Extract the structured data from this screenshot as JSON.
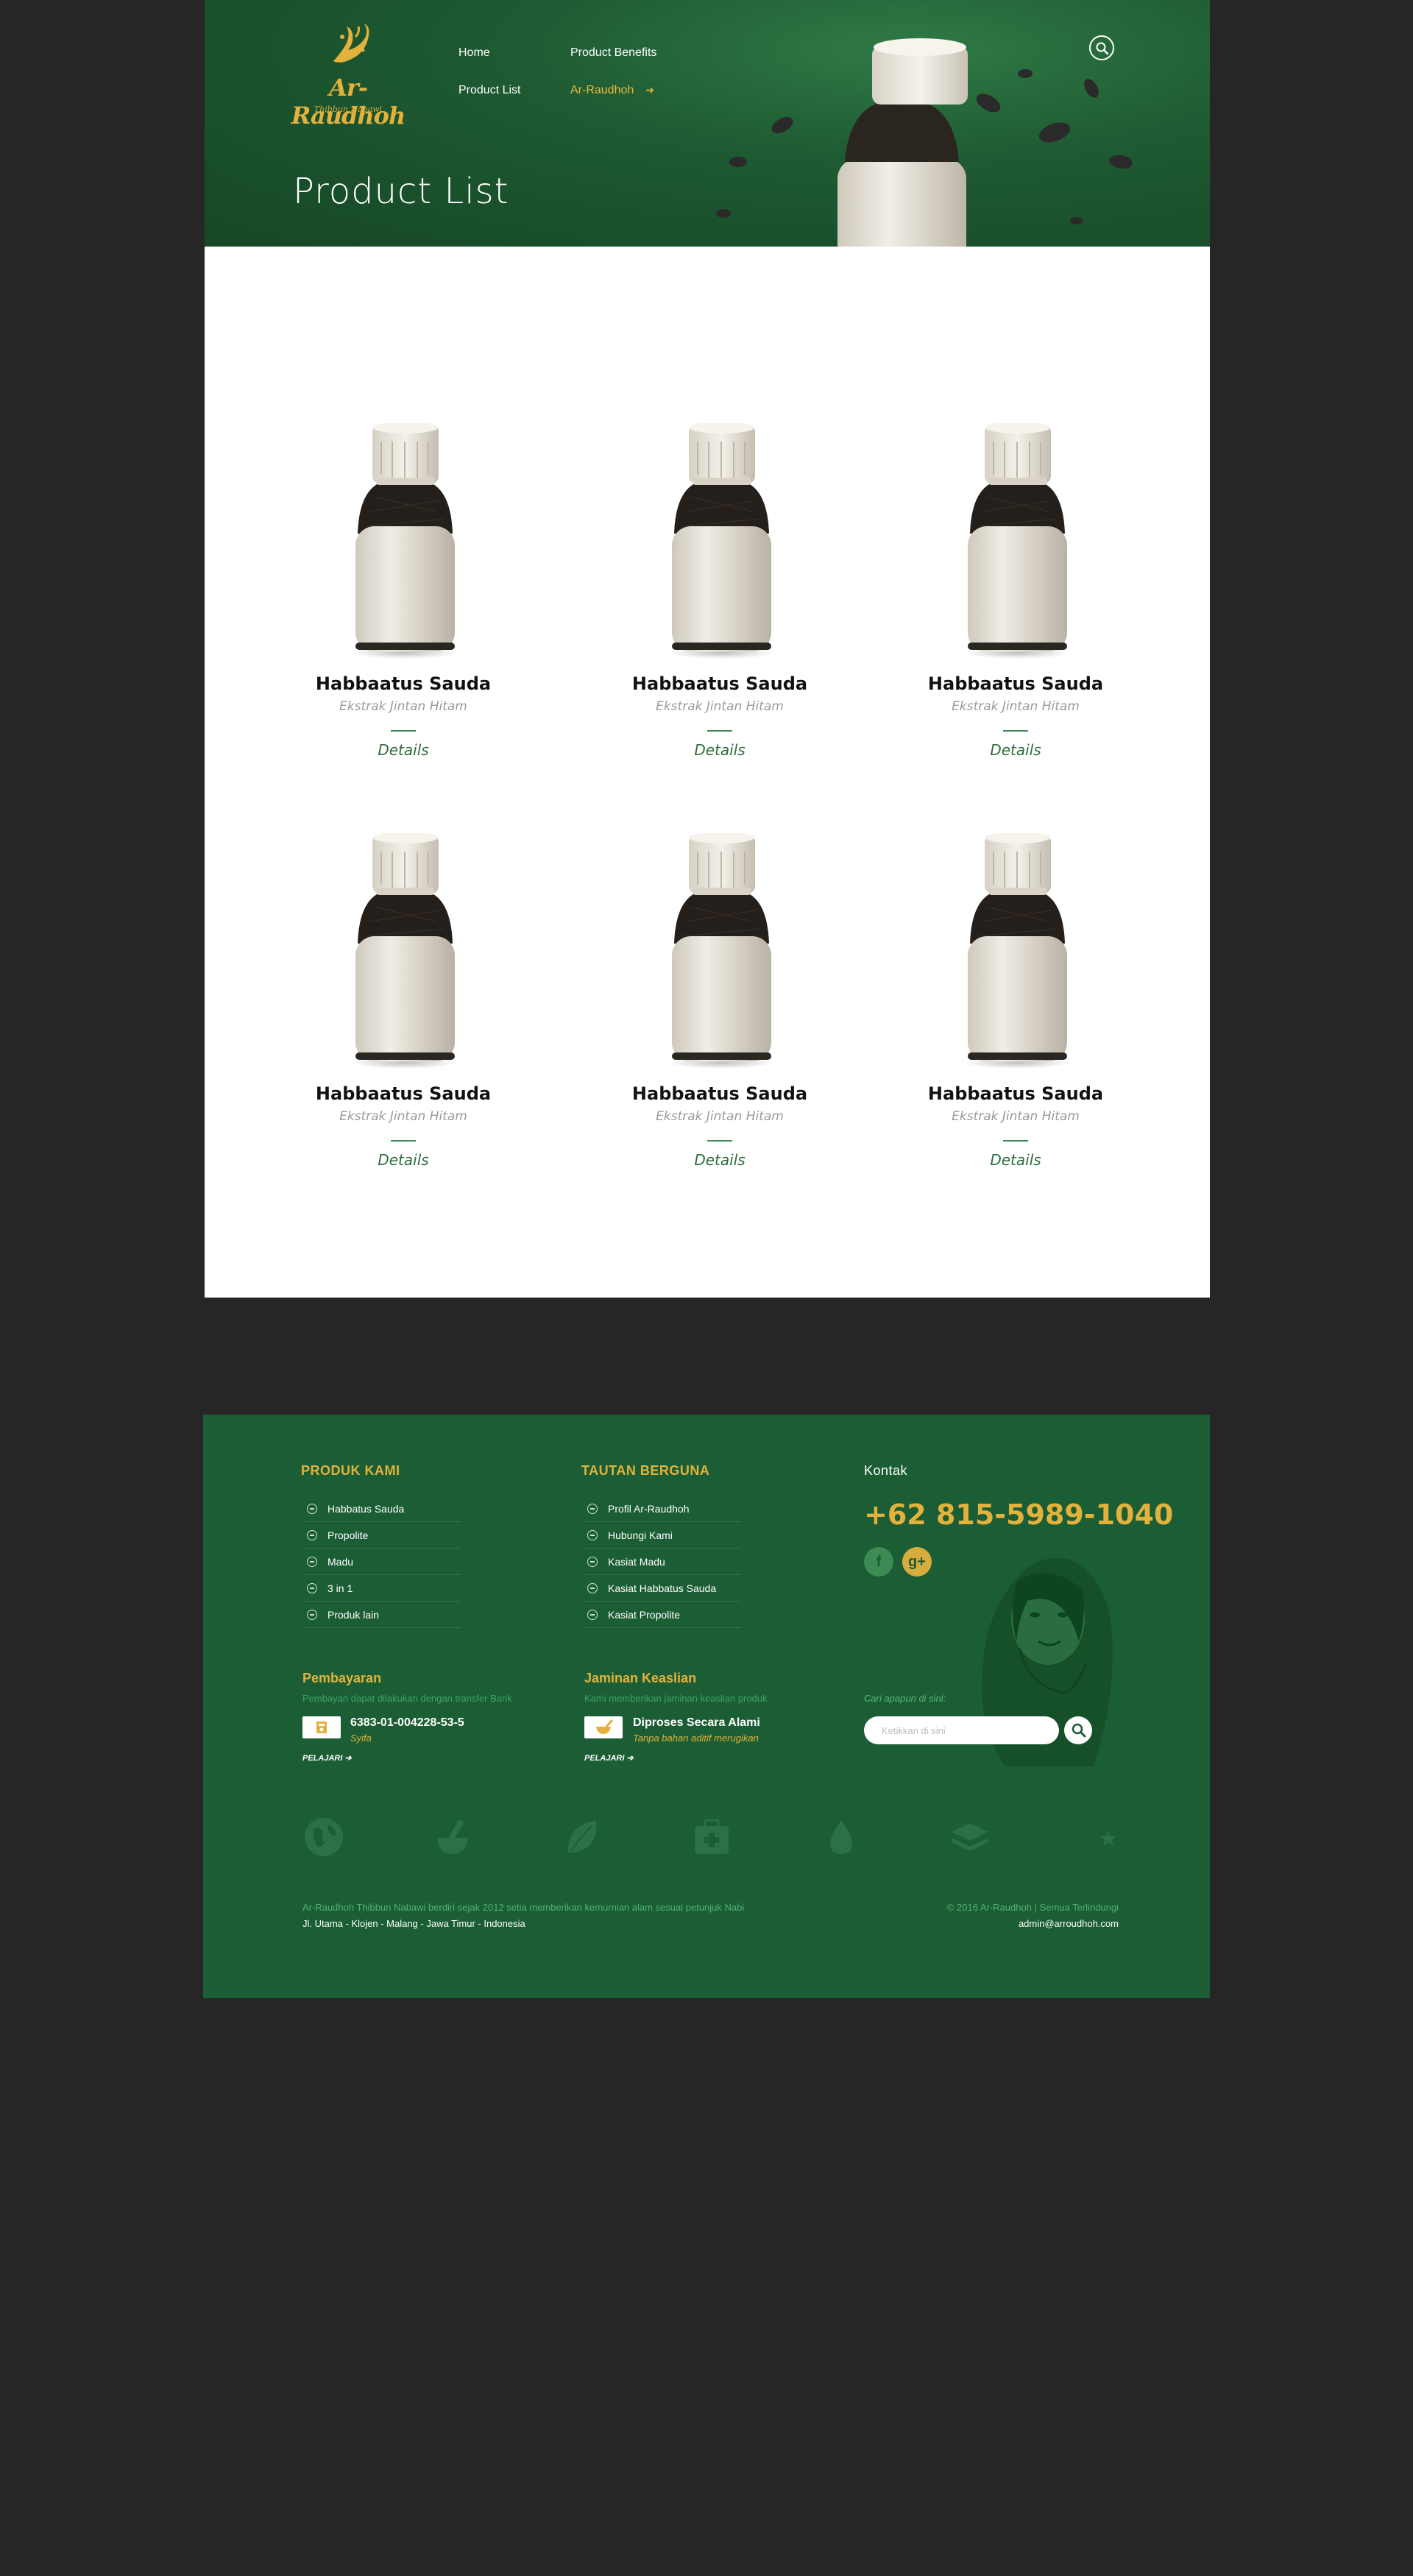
{
  "brand": {
    "name": "Ar-Raudhoh",
    "tagline": "Thibbun Nabawi",
    "gold": "#e3b23c",
    "green": "#1b5d34"
  },
  "nav": {
    "items": [
      {
        "label": "Home"
      },
      {
        "label": "Product Benefits"
      },
      {
        "label": "Product List"
      },
      {
        "label": "Ar-Raudhoh",
        "active": true
      }
    ],
    "search_icon": "search-icon"
  },
  "header": {
    "page_title": "Product List"
  },
  "products": [
    {
      "name": "Habbaatus Sauda",
      "subtitle": "Ekstrak Jintan Hitam",
      "link": "Details"
    },
    {
      "name": "Habbaatus Sauda",
      "subtitle": "Ekstrak Jintan Hitam",
      "link": "Details"
    },
    {
      "name": "Habbaatus Sauda",
      "subtitle": "Ekstrak Jintan Hitam",
      "link": "Details"
    },
    {
      "name": "Habbaatus Sauda",
      "subtitle": "Ekstrak Jintan Hitam",
      "link": "Details"
    },
    {
      "name": "Habbaatus Sauda",
      "subtitle": "Ekstrak Jintan Hitam",
      "link": "Details"
    },
    {
      "name": "Habbaatus Sauda",
      "subtitle": "Ekstrak Jintan Hitam",
      "link": "Details"
    }
  ],
  "footer": {
    "products": {
      "heading": "PRODUK KAMI",
      "items": [
        "Habbatus Sauda",
        "Propolite",
        "Madu",
        "3 in 1",
        "Produk lain"
      ]
    },
    "links": {
      "heading": "TAUTAN BERGUNA",
      "items": [
        "Profil Ar-Raudhoh",
        "Hubungi Kami",
        "Kasiat Madu",
        "Kasiat Habbatus Sauda",
        "Kasiat Propolite"
      ]
    },
    "contact": {
      "heading": "Kontak",
      "phone": "+62 815-5989-1040",
      "social": [
        {
          "icon": "facebook-icon",
          "glyph": "f"
        },
        {
          "icon": "google-plus-icon",
          "glyph": "g+"
        }
      ]
    },
    "payment": {
      "title": "Pembayaran",
      "subtitle": "Pembayari dapat dilakukan dengan transfer Bank",
      "account": "6383-01-004228-53-5",
      "holder": "Syifa",
      "more": "PELAJARI"
    },
    "guarantee": {
      "title": "Jaminan Keaslian",
      "subtitle": "Kami memberikan jaminan keaslian produk",
      "value": "Diproses Secara Alami",
      "note": "Tanpa bahan aditif merugikan",
      "more": "PELAJARI"
    },
    "search": {
      "label": "Cari apapun di sini:",
      "placeholder": "Ketikkan di sini"
    },
    "icons": [
      "globe-icon",
      "mortar-pestle-icon",
      "leaf-icon",
      "first-aid-icon",
      "drop-icon",
      "quran-icon",
      "crescent-star-icon"
    ],
    "about": "Ar-Raudhoh Thibbun Nabawi berdiri sejak 2012 setia memberikan kemurnian alam sesuai petunjuk Nabi",
    "address": "Jl. Utama - Klojen - Malang - Jawa Timur - Indonesia",
    "copyright": "© 2016 Ar-Raudhoh | Semua Terlindungi",
    "email": "admin@arroudhoh.com"
  }
}
